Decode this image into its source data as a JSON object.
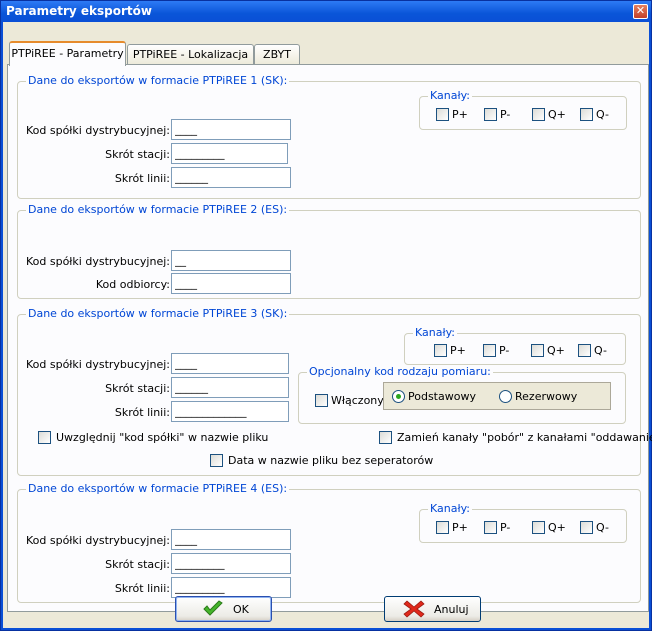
{
  "window": {
    "title": "Parametry eksportów",
    "close_glyph": "✕"
  },
  "tabs": [
    "PTPiREE - Parametry",
    "PTPiREE - Lokalizacja",
    "ZBYT"
  ],
  "group1": {
    "title": "Dane do eksportów w formacie PTPiREE 1 (SK):",
    "kod_label": "Kod spółki dystrybucyjnej:",
    "kod_value": "____",
    "stacja_label": "Skrót stacji:",
    "stacja_value": "_________",
    "linia_label": "Skrót linii:",
    "linia_value": "______",
    "kanaly_title": "Kanały:",
    "channels": [
      "P+",
      "P-",
      "Q+",
      "Q-"
    ]
  },
  "group2": {
    "title": "Dane do eksportów w formacie PTPiREE 2 (ES):",
    "kod_label": "Kod spółki dystrybucyjnej:",
    "kod_value": "__",
    "odbiorca_label": "Kod odbiorcy:",
    "odbiorca_value": "____"
  },
  "group3": {
    "title": "Dane do eksportów w formacie PTPiREE 3 (SK):",
    "kod_label": "Kod spółki dystrybucyjnej:",
    "kod_value": "____",
    "stacja_label": "Skrót stacji:",
    "stacja_value": "______",
    "linia_label": "Skrót linii:",
    "linia_value": "_____________",
    "kanaly_title": "Kanały:",
    "channels": [
      "P+",
      "P-",
      "Q+",
      "Q-"
    ],
    "opt_title": "Opcjonalny kod rodzaju pomiaru:",
    "wlaczony_label": "Włączony",
    "podstawowy_label": "Podstawowy",
    "rezerwowy_label": "Rezerwowy",
    "uwzglednij_label": "Uwzględnij \"kod spółki\" w nazwie pliku",
    "zamien_label": "Zamień kanały \"pobór\" z kanałami \"oddawanie\"",
    "data_label": "Data w nazwie pliku bez seperatorów"
  },
  "group4": {
    "title": "Dane do eksportów w formacie PTPiREE 4 (ES):",
    "kod_label": "Kod spółki dystrybucyjnej:",
    "kod_value": "____",
    "stacja_label": "Skrót stacji:",
    "stacja_value": "_________",
    "linia_label": "Skrót linii:",
    "linia_value": "_________",
    "kanaly_title": "Kanały:",
    "channels": [
      "P+",
      "P-",
      "Q+",
      "Q-"
    ]
  },
  "buttons": {
    "ok": "OK",
    "cancel": "Anuluj"
  },
  "colors": {
    "group_title": "#0046d5",
    "titlebar": "#0a4fd6",
    "radio_dot": "#2aa61e"
  }
}
